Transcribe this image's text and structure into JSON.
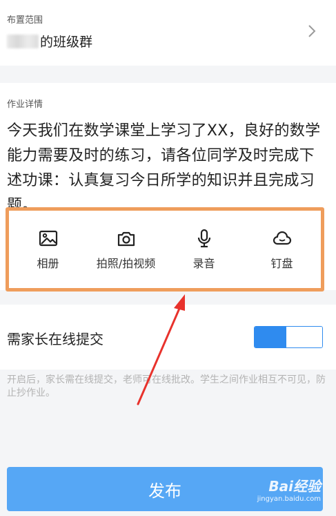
{
  "scope": {
    "label": "布置范围",
    "value": "的班级群"
  },
  "details": {
    "label": "作业详情",
    "text": "今天我们在数学课堂上学习了XX，良好的数学能力需要及时的练习，请各位同学及时完成下述功课：认真复习今日所学的知识并且完成习题。"
  },
  "toolbar": {
    "items": [
      {
        "label": "相册",
        "icon": "image-icon"
      },
      {
        "label": "拍照/拍视频",
        "icon": "camera-icon"
      },
      {
        "label": "录音",
        "icon": "microphone-icon"
      },
      {
        "label": "钉盘",
        "icon": "cloud-icon"
      }
    ]
  },
  "parent_submit": {
    "label": "需家长在线提交",
    "enabled": true
  },
  "hint": "开启后，家长需在线提交，老师可在线批改。学生之间作业相互不可见，防止抄作业。",
  "publish_label": "发布",
  "watermark": {
    "main": "Bai经验",
    "sub": "jingyan.baidu.com"
  },
  "colors": {
    "accent": "#2f8bef",
    "publish_button": "#56a7f5",
    "highlight_box": "#ef9d5c",
    "annotation_arrow": "#e8322c"
  }
}
